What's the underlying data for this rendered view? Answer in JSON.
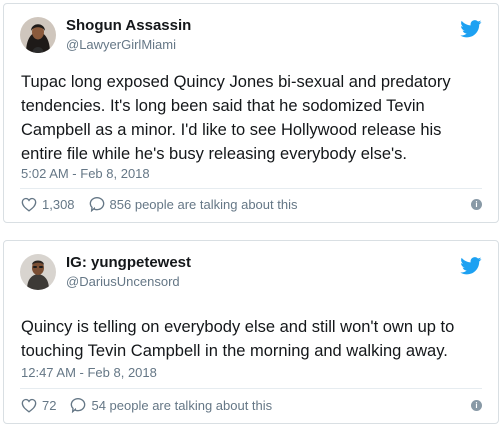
{
  "colors": {
    "twitter_blue": "#1da1f2",
    "muted": "#657786",
    "text": "#14171a"
  },
  "tweets": [
    {
      "display_name": "Shogun Assassin",
      "handle": "@LawyerGirlMiami",
      "text": "Tupac long exposed Quincy Jones bi-sexual and predatory tendencies. It's long been said that he sodomized Tevin Campbell as a minor. I'd like to see Hollywood release his entire file while he's busy releasing everybody else's.",
      "timestamp": "5:02 AM - Feb 8, 2018",
      "likes": "1,308",
      "replies_label": "856 people are talking about this",
      "icons": [
        "twitter-bird-icon",
        "heart-icon",
        "reply-bubble-icon",
        "info-icon"
      ]
    },
    {
      "display_name": "IG: yungpetewest",
      "handle": "@DariusUncensord",
      "text": "Quincy is telling on everybody else and still won't own up to touching Tevin Campbell in the morning and walking away.",
      "timestamp": "12:47 AM - Feb 8, 2018",
      "likes": "72",
      "replies_label": "54 people are talking about this",
      "icons": [
        "twitter-bird-icon",
        "heart-icon",
        "reply-bubble-icon",
        "info-icon"
      ]
    }
  ],
  "info_glyph": "i"
}
